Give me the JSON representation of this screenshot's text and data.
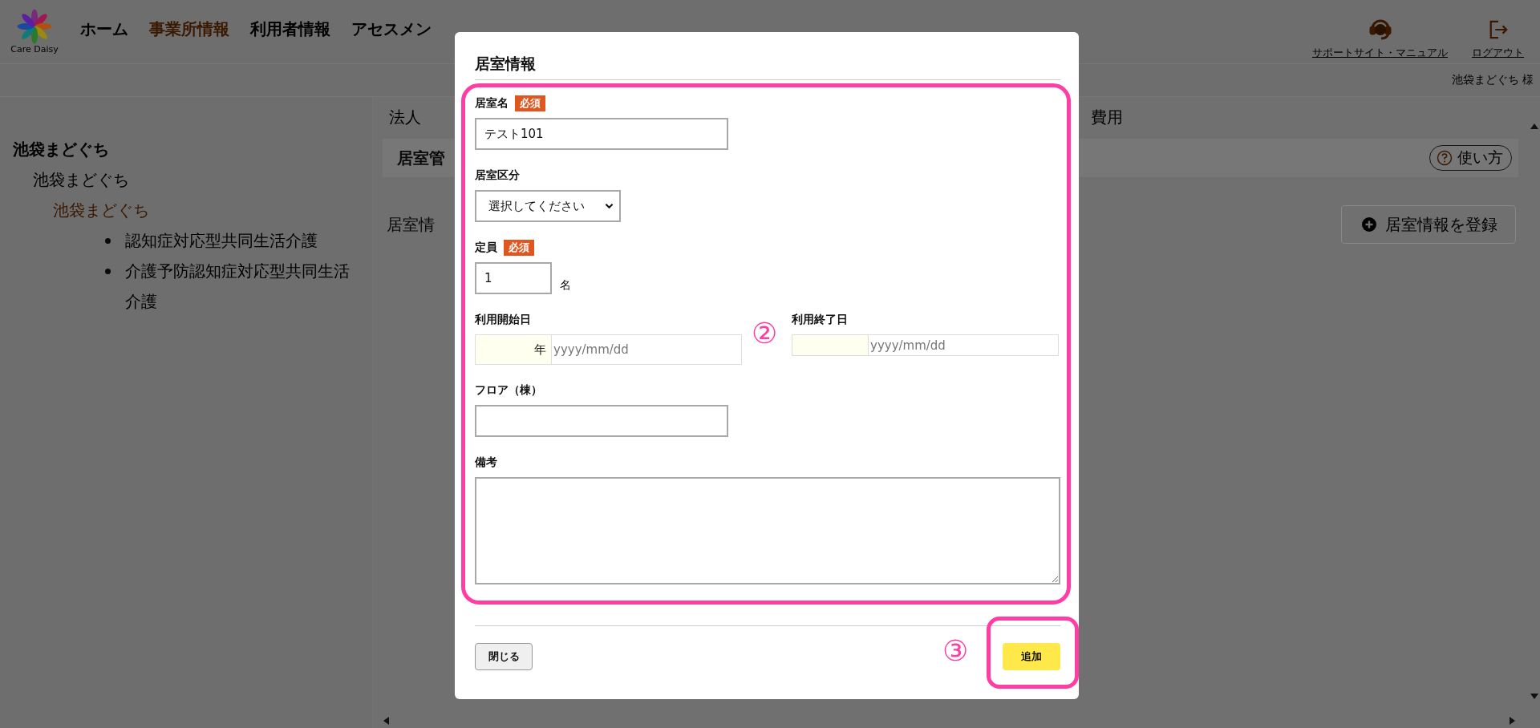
{
  "header": {
    "logo_text": "Care Daisy",
    "nav": [
      {
        "label": "ホーム",
        "selected": false
      },
      {
        "label": "事業所情報",
        "selected": true
      },
      {
        "label": "利用者情報",
        "selected": false
      },
      {
        "label": "アセスメン",
        "selected": false
      }
    ],
    "support_link": "サポートサイト・マニュアル",
    "logout_link": "ログアウト",
    "user": "池袋まどぐち 様"
  },
  "sidebar": {
    "tree": [
      {
        "label": "池袋まどぐち",
        "selected": false,
        "children": [
          {
            "label": "池袋まどぐち",
            "selected": false,
            "children": [
              {
                "label": "池袋まどぐち",
                "selected": true,
                "children": [
                  {
                    "label": "認知症対応型共同生活介護",
                    "selected": false
                  },
                  {
                    "label": "介護予防認知症対応型共同生活介護",
                    "selected": false
                  }
                ]
              }
            ]
          }
        ]
      }
    ]
  },
  "main": {
    "tabs": [
      {
        "label": "法人",
        "selected": false
      },
      {
        "label": "費用",
        "selected": false
      }
    ],
    "section_title": "居室管",
    "help_button": "使い方",
    "list_label": "居室情",
    "register_button": "居室情報を登録"
  },
  "modal": {
    "title": "居室情報",
    "fields": [
      {
        "kind": "text",
        "label": "居室名",
        "badge": "必須",
        "value": "テスト101"
      },
      {
        "kind": "select",
        "label": "居室区分",
        "value": "選択してください"
      },
      {
        "kind": "number",
        "label": "定員",
        "badge": "必須",
        "value": "1",
        "unit": "名"
      },
      {
        "kind": "dates",
        "dates": [
          {
            "label": "利用開始日",
            "era": "年",
            "placeholder": "yyyy/mm/dd"
          },
          {
            "label": "利用終了日",
            "placeholder": "yyyy/mm/dd"
          }
        ]
      },
      {
        "kind": "text",
        "label": "フロア（棟）"
      },
      {
        "kind": "textarea",
        "label": "備考"
      }
    ],
    "close_button": "閉じる",
    "add_button": "追加"
  },
  "annotations": [
    {
      "label": "②"
    },
    {
      "label": "③"
    }
  ]
}
